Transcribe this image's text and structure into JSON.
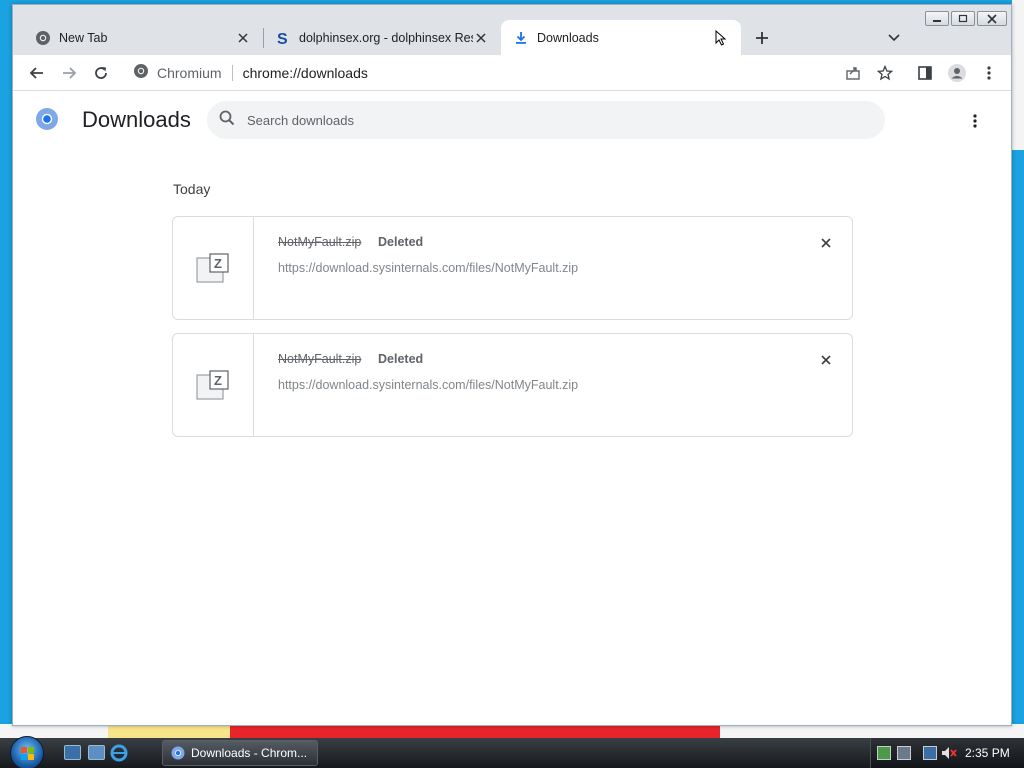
{
  "browser": {
    "tabs": [
      {
        "title": "New Tab",
        "icon": "chromium-icon",
        "active": false
      },
      {
        "title": "dolphinsex.org - dolphinsex Reso",
        "icon": "s-logo-icon",
        "active": false
      },
      {
        "title": "Downloads",
        "icon": "download-icon",
        "active": true
      }
    ],
    "omnibox": {
      "site_label": "Chromium",
      "url": "chrome://downloads"
    }
  },
  "downloads_page": {
    "title": "Downloads",
    "search": {
      "placeholder": "Search downloads",
      "value": ""
    },
    "section_label": "Today",
    "items": [
      {
        "filename": "NotMyFault.zip",
        "status": "Deleted",
        "url": "https://download.sysinternals.com/files/NotMyFault.zip"
      },
      {
        "filename": "NotMyFault.zip",
        "status": "Deleted",
        "url": "https://download.sysinternals.com/files/NotMyFault.zip"
      }
    ]
  },
  "taskbar": {
    "task_label": "Downloads - Chrom...",
    "clock": "2:35 PM"
  },
  "colors": {
    "accent": "#1a73e8",
    "desktop": "#1aa3e0"
  }
}
